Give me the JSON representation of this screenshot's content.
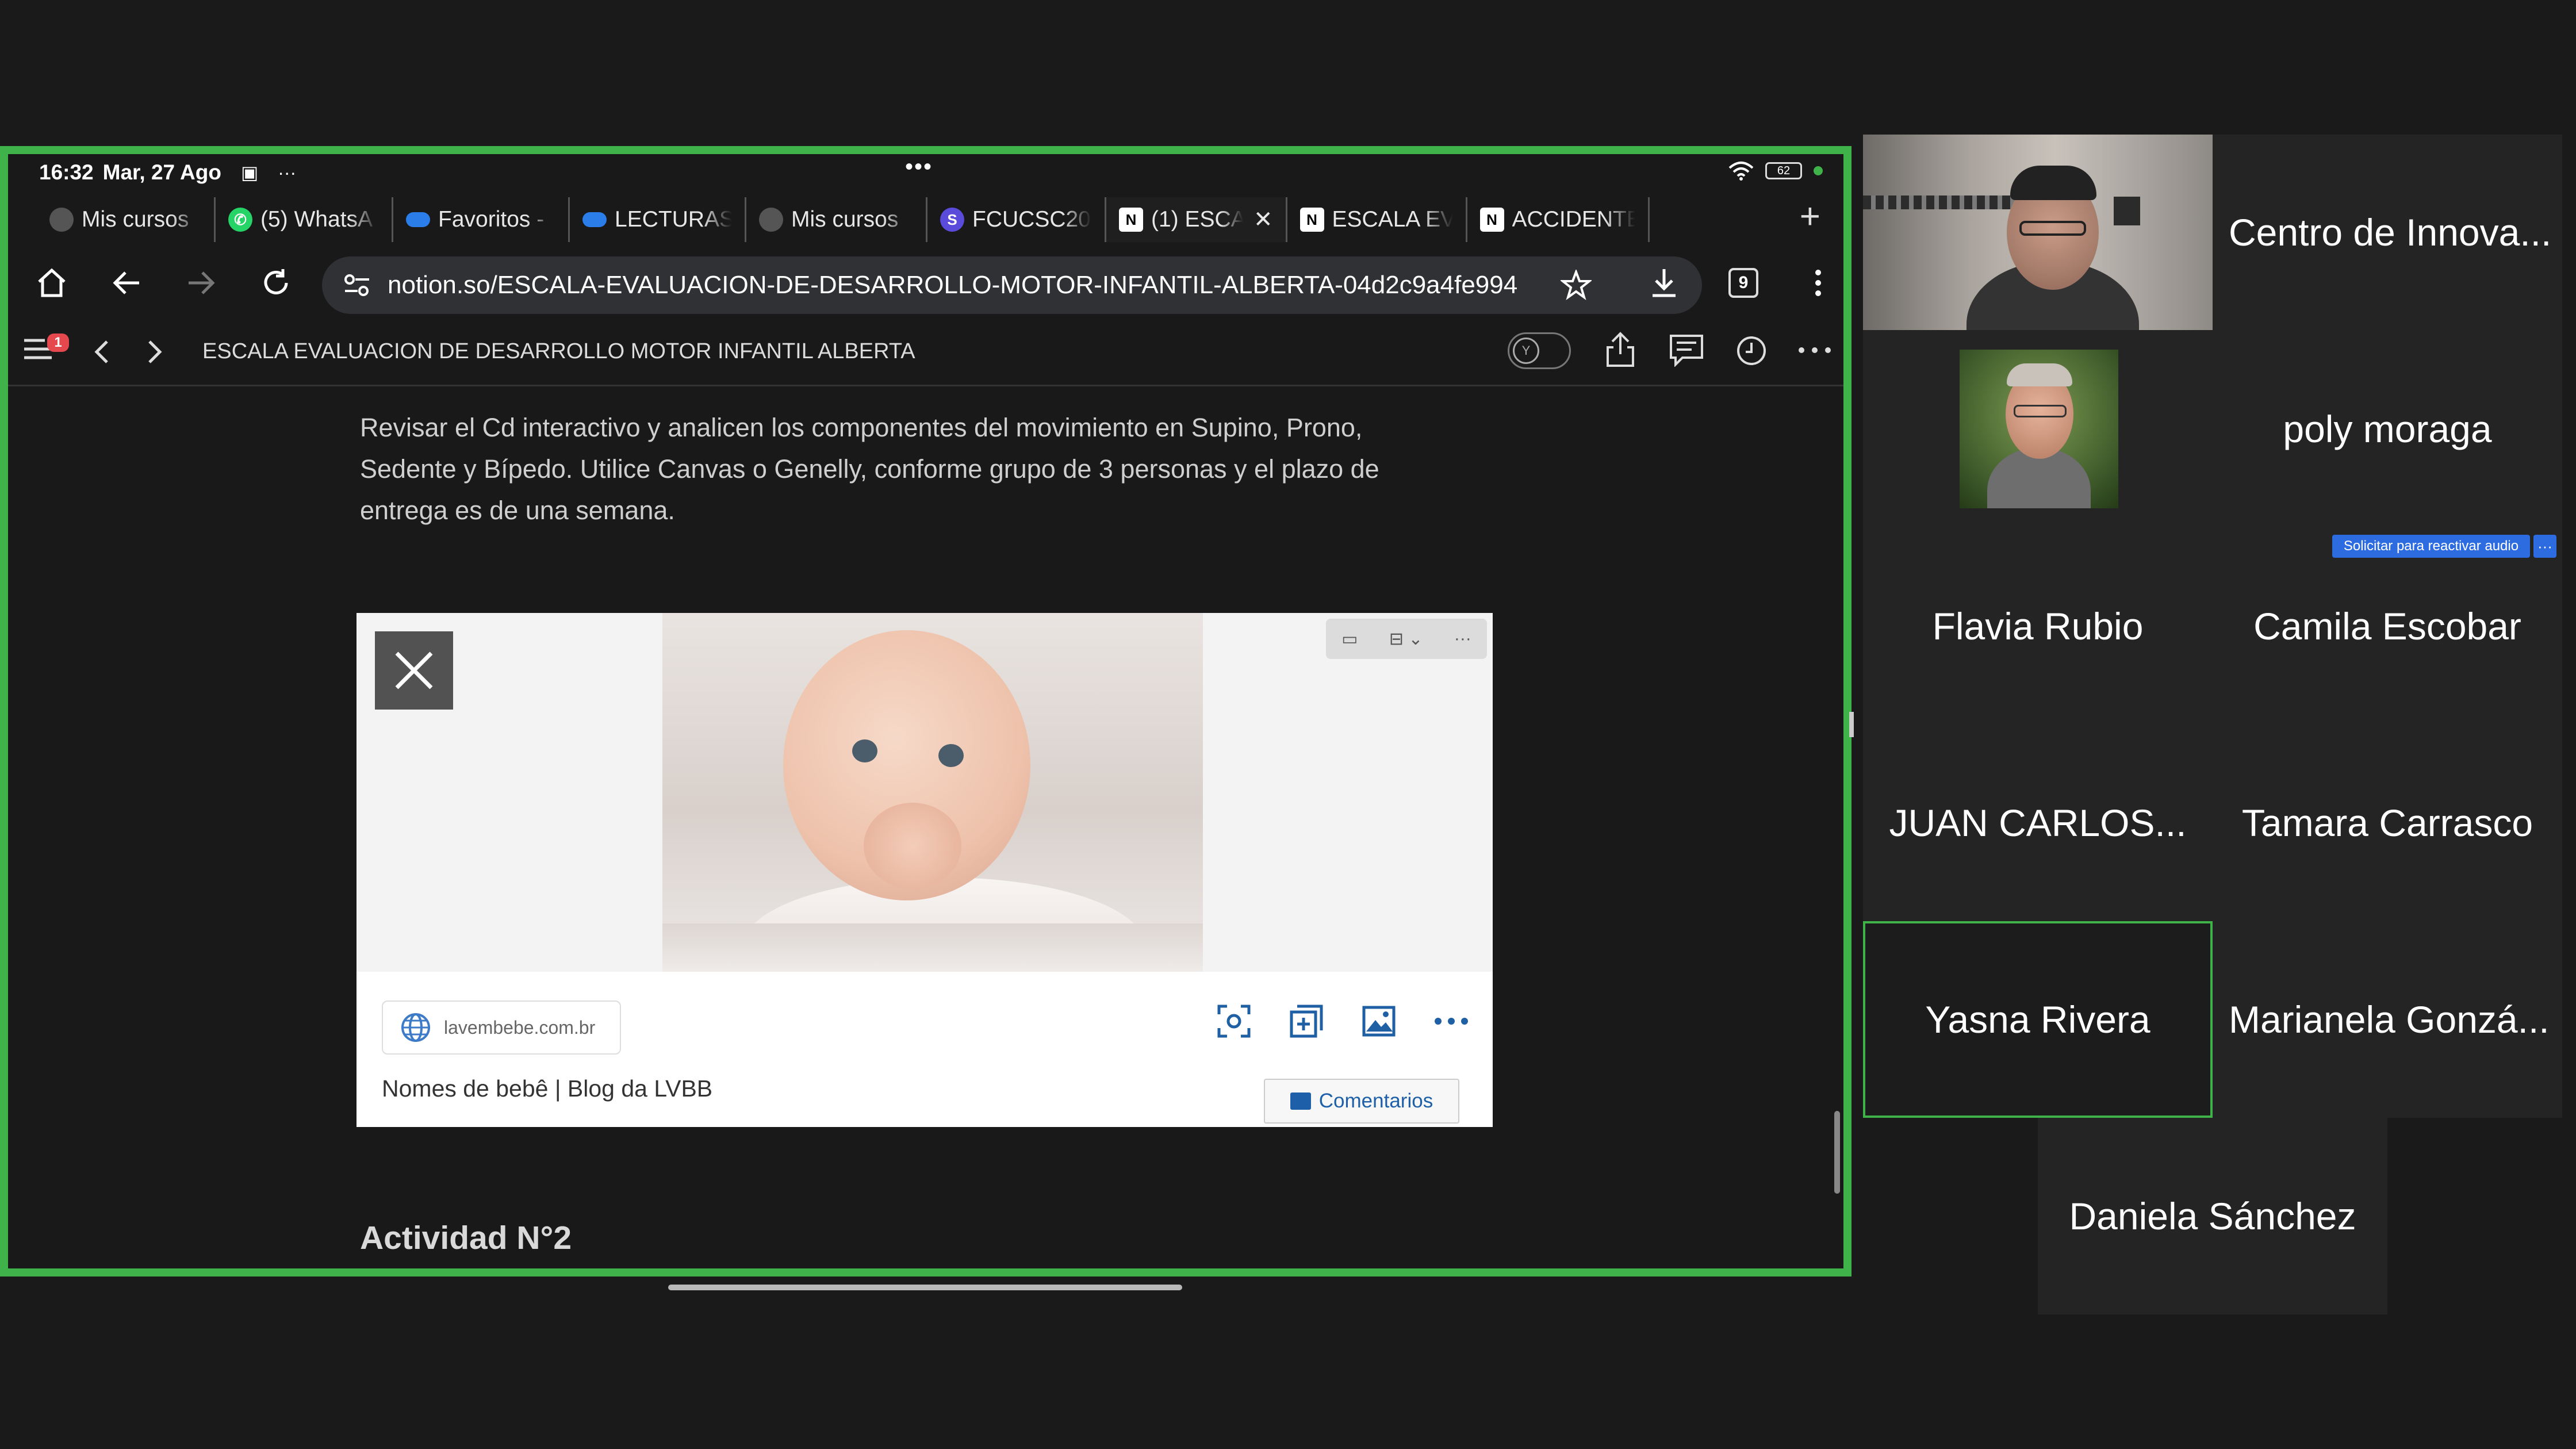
{
  "status_bar": {
    "time": "16:32",
    "date": "Mar, 27 Ago",
    "battery": "62"
  },
  "tabs": [
    {
      "label": "Mis cursos",
      "icon": "moodle-icon"
    },
    {
      "label": "(5) WhatsA",
      "icon": "whatsapp-icon"
    },
    {
      "label": "Favoritos -",
      "icon": "onedrive-icon"
    },
    {
      "label": "LECTURAS",
      "icon": "onedrive-icon"
    },
    {
      "label": "Mis cursos",
      "icon": "moodle-icon"
    },
    {
      "label": "FCUCSC20",
      "icon": "app-icon"
    },
    {
      "label": "(1) ESCA",
      "icon": "notion-icon",
      "active": true
    },
    {
      "label": "ESCALA EV",
      "icon": "notion-icon"
    },
    {
      "label": "ACCIDENTE",
      "icon": "notion-icon"
    }
  ],
  "address_bar": {
    "url": "notion.so/ESCALA-EVALUACION-DE-DESARROLLO-MOTOR-INFANTIL-ALBERTA-04d2c9a4fe994",
    "tab_count": "9"
  },
  "notion": {
    "badge": "1",
    "page_title": "ESCALA EVALUACION DE DESARROLLO MOTOR INFANTIL ALBERTA",
    "toggle_label": "Y"
  },
  "content": {
    "paragraph_lines": [
      "Revisar el Cd interactivo y analicen  los componentes del movimiento en Supino, Prono,",
      "Sedente y Bípedo.  Utilice Canvas o Genelly, conforme  grupo de 3 personas y el plazo de",
      "entrega es de una semana."
    ],
    "embed": {
      "source": "lavembebe.com.br",
      "caption": "Nomes de bebê | Blog da LVBB",
      "comments_label": "Comentarios"
    },
    "heading2": "Actividad N°2"
  },
  "participants": [
    {
      "name": "Centro de Innova...",
      "video": true
    },
    {
      "name": "poly moraga",
      "video": true
    },
    {
      "name": "Flavia Rubio"
    },
    {
      "name": "Camila Escobar"
    },
    {
      "name": "JUAN CARLOS..."
    },
    {
      "name": "Tamara Carrasco"
    },
    {
      "name": "Yasna Rivera",
      "speaking": true
    },
    {
      "name": "Marianela Gonzá..."
    },
    {
      "name": "Daniela Sánchez"
    }
  ],
  "audio_request": {
    "label": "Solicitar para reactivar audio",
    "more": "···"
  },
  "colors": {
    "share_border": "#3fb34a",
    "accent_blue": "#2d6be0",
    "badge_red": "#e5484d"
  }
}
